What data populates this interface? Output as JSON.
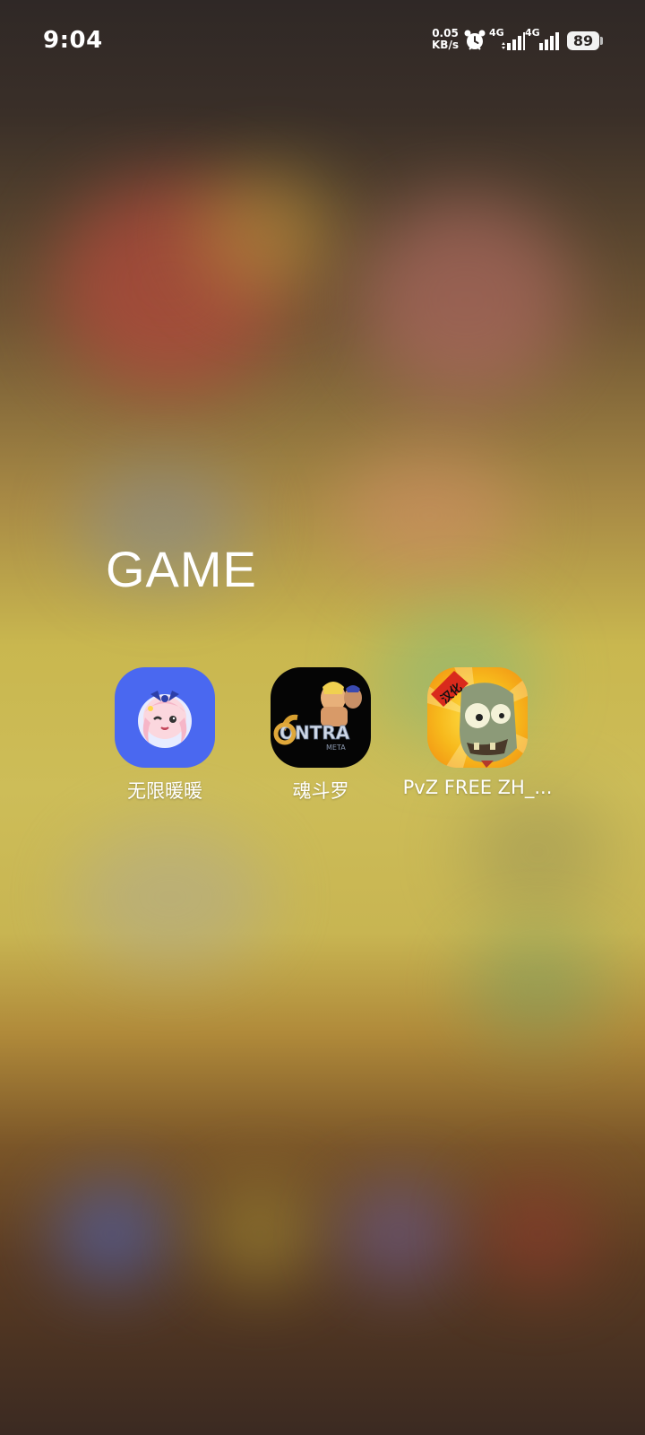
{
  "status_bar": {
    "time": "9:04",
    "net_speed_value": "0.05",
    "net_speed_unit": "KB/s",
    "sim1_label": "4G",
    "sim2_label": "4G",
    "battery": "89",
    "icons": [
      "alarm-icon",
      "signal-icon",
      "signal-icon"
    ]
  },
  "folder": {
    "title": "GAME",
    "apps": [
      {
        "label": "无限暖暖",
        "icon": "anime-girl-icon",
        "color": "#4a68f0"
      },
      {
        "label": "魂斗罗",
        "icon": "contra-icon",
        "color": "#050505"
      },
      {
        "label": "PvZ FREE ZH_...",
        "icon": "zombie-icon",
        "color": "#f7b91c"
      }
    ]
  },
  "colors": {
    "background_top": "#2f2826",
    "background_mid": "#cdbd58",
    "background_bottom": "#3b2a22"
  }
}
